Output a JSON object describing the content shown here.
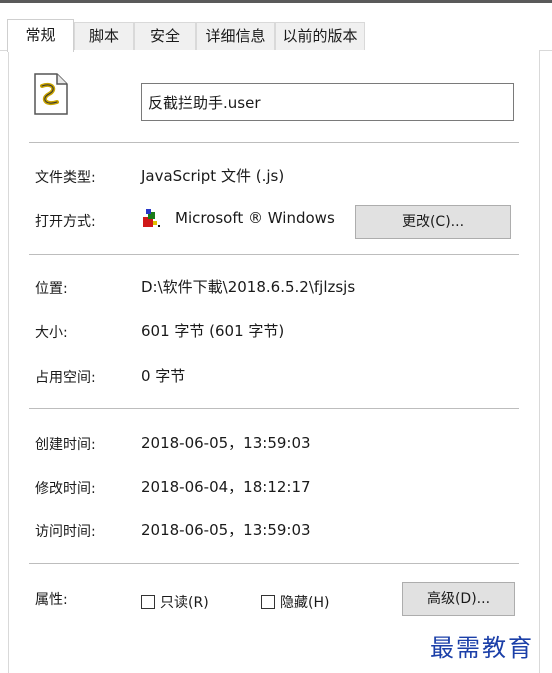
{
  "tabs": [
    {
      "label": "常规",
      "active": true
    },
    {
      "label": "脚本",
      "active": false
    },
    {
      "label": "安全",
      "active": false
    },
    {
      "label": "详细信息",
      "active": false
    },
    {
      "label": "以前的版本",
      "active": false
    }
  ],
  "file": {
    "icon": "script-file-icon",
    "name": "反截拦助手.user"
  },
  "type_row": {
    "label": "文件类型:",
    "value": "JavaScript 文件 (.js)"
  },
  "open_row": {
    "label": "打开方式:",
    "app_icon": "windows-script-host-icon",
    "value": "Microsoft ® Windows",
    "change_button": "更改(C)..."
  },
  "location_row": {
    "label": "位置:",
    "value": "D:\\软件下載\\2018.6.5.2\\fjlzsjs"
  },
  "size_row": {
    "label": "大小:",
    "value": "601 字节 (601 字节)"
  },
  "disk_row": {
    "label": "占用空间:",
    "value": "0 字节"
  },
  "created_row": {
    "label": "创建时间:",
    "value": "2018-06-05，13:59:03"
  },
  "modified_row": {
    "label": "修改时间:",
    "value": "2018-06-04，18:12:17"
  },
  "accessed_row": {
    "label": "访问时间:",
    "value": "2018-06-05，13:59:03"
  },
  "attributes": {
    "label": "属性:",
    "readonly_label": "只读(R)",
    "readonly_checked": false,
    "hidden_label": "隐藏(H)",
    "hidden_checked": false,
    "advanced_button": "高级(D)..."
  },
  "watermark": "最需教育",
  "colors": {
    "separator": "#bdbdbd",
    "button_bg": "#e1e1e1",
    "watermark": "#1b3fa8"
  }
}
